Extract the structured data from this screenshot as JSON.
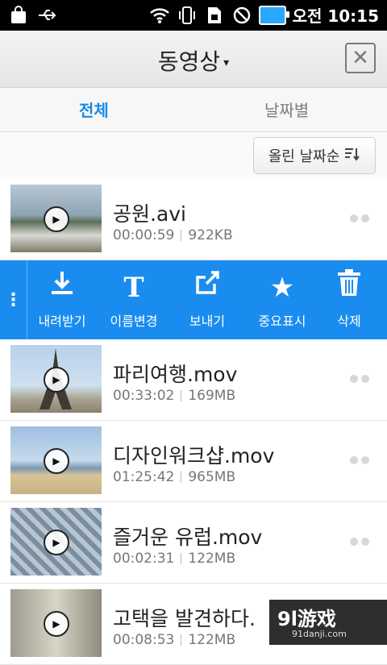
{
  "status_bar": {
    "time": "오전 10:15",
    "icons": [
      "bag-icon",
      "usb-icon",
      "wifi-icon",
      "vibrate-icon",
      "sim-icon",
      "no-sign-icon",
      "battery-icon"
    ]
  },
  "header": {
    "title": "동영상",
    "title_caret": "▾",
    "close_glyph": "✕"
  },
  "tabs": [
    {
      "label": "전체",
      "active": true
    },
    {
      "label": "날짜별",
      "active": false
    }
  ],
  "sort": {
    "label": "올린 날짜순",
    "icon": "sort-icon"
  },
  "videos": [
    {
      "name": "공원.avi",
      "duration": "00:00:59",
      "size": "922KB"
    },
    {
      "name": "파리여행.mov",
      "duration": "00:33:02",
      "size": "169MB"
    },
    {
      "name": "디자인워크샵.mov",
      "duration": "01:25:42",
      "size": "965MB"
    },
    {
      "name": "즐거운 유럽.mov",
      "duration": "00:02:31",
      "size": "122MB"
    },
    {
      "name": "고택을 발견하다.",
      "duration": "00:08:53",
      "size": "122MB"
    }
  ],
  "actions": [
    {
      "label": "내려받기",
      "icon": "download-icon"
    },
    {
      "label": "이름변경",
      "icon": "rename-icon"
    },
    {
      "label": "보내기",
      "icon": "share-icon"
    },
    {
      "label": "중요표시",
      "icon": "star-icon"
    },
    {
      "label": "삭제",
      "icon": "trash-icon"
    }
  ],
  "watermark": {
    "brand": "9l游戏",
    "url": "91danji.com"
  },
  "colors": {
    "accent": "#1a8cf0",
    "tab_active": "#1a8ae6"
  }
}
